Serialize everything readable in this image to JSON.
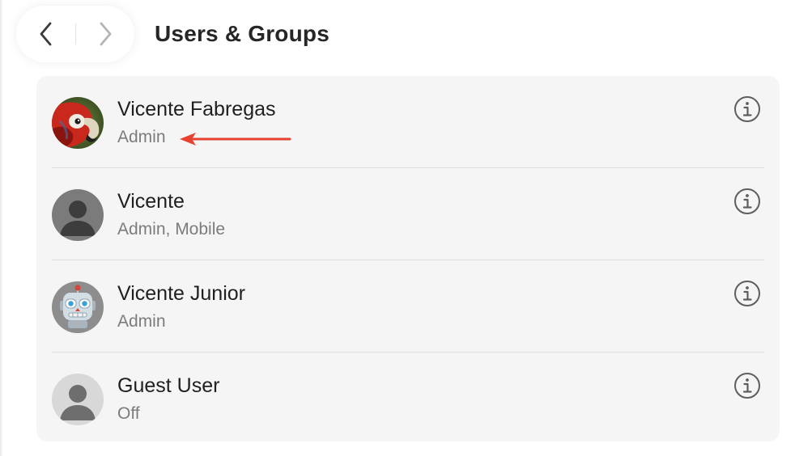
{
  "header": {
    "title": "Users & Groups",
    "back_icon": "chevron-left-icon",
    "forward_icon": "chevron-right-icon"
  },
  "users": [
    {
      "name": "Vicente Fabregas",
      "role": "Admin",
      "avatar": "parrot-photo"
    },
    {
      "name": "Vicente",
      "role": "Admin, Mobile",
      "avatar": "person-silhouette"
    },
    {
      "name": "Vicente Junior",
      "role": "Admin",
      "avatar": "robot"
    },
    {
      "name": "Guest User",
      "role": "Off",
      "avatar": "person-silhouette-light"
    }
  ],
  "info_icon": "info-circle-icon",
  "annotation": {
    "color": "#e8412f",
    "points_to": "users.0.role"
  },
  "colors": {
    "card_background": "#f5f5f5",
    "title_text": "#262626",
    "secondary_text": "#7c7c7c"
  }
}
